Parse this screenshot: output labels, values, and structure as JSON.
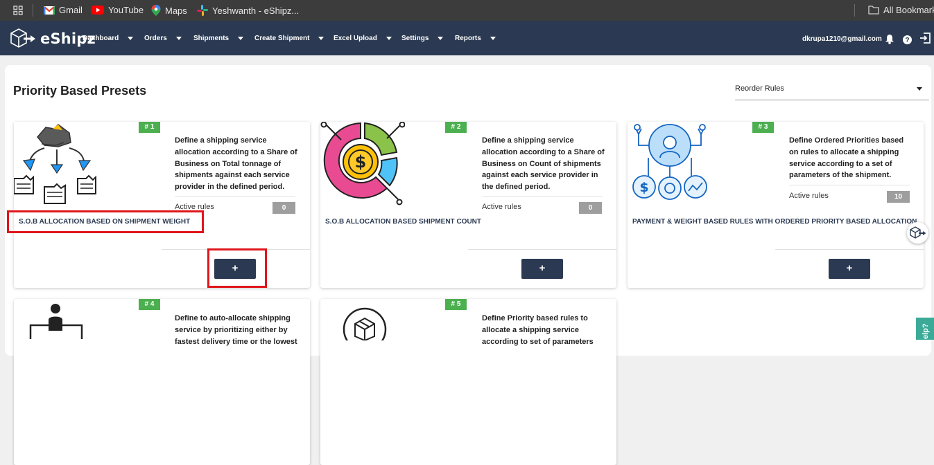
{
  "bookmarks": {
    "items": [
      {
        "label": "Gmail",
        "icon": "gmail-icon"
      },
      {
        "label": "YouTube",
        "icon": "youtube-icon"
      },
      {
        "label": "Maps",
        "icon": "maps-icon"
      },
      {
        "label": "Yeshwanth - eShipz...",
        "icon": "slack-icon"
      }
    ],
    "all_bookmarks": "All Bookmarks"
  },
  "nav": {
    "brand": "eShipz",
    "menu": [
      "Dashboard",
      "Orders",
      "Shipments",
      "Create Shipment",
      "Excel Upload",
      "Settings",
      "Reports"
    ],
    "email": "dkrupa1210@gmail.com"
  },
  "page": {
    "title": "Priority Based Presets",
    "reorder_label": "Reorder Rules"
  },
  "cards": [
    {
      "badge": "# 1",
      "desc": "Define a shipping service allocation according to a Share of Business on Total tonnage of shipments against each service provider in the defined period.",
      "active_label": "Active rules",
      "count": "0",
      "title": "S.O.B ALLOCATION BASED ON SHIPMENT WEIGHT",
      "add": "+",
      "icon": "weight-allocation-icon"
    },
    {
      "badge": "# 2",
      "desc": "Define a shipping service allocation according to a Share of Business on Count of shipments against each service provider in the defined period.",
      "active_label": "Active rules",
      "count": "0",
      "title": "S.O.B ALLOCATION BASED SHIPMENT COUNT",
      "add": "+",
      "icon": "dollar-pie-chart-icon"
    },
    {
      "badge": "# 3",
      "desc": "Define Ordered Priorities based on rules to allocate a shipping service according to a set of parameters of the shipment.",
      "active_label": "Active rules",
      "count": "10",
      "title": "PAYMENT & WEIGHT BASED RULES WITH ORDERED PRIORITY BASED ALLOCATION",
      "add": "+",
      "icon": "priority-network-icon"
    },
    {
      "badge": "# 4",
      "desc": "Define to auto-allocate shipping service by prioritizing either by fastest delivery time or the lowest",
      "icon": "person-hierarchy-icon"
    },
    {
      "badge": "# 5",
      "desc": "Define Priority based rules to allocate a shipping service according to set of parameters",
      "icon": "package-box-icon"
    }
  ],
  "help_label": "elp?"
}
